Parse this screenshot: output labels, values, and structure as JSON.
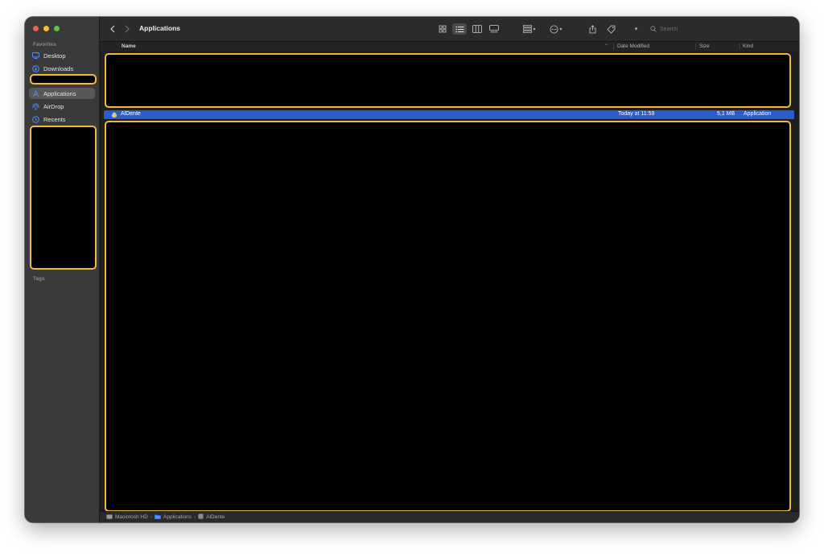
{
  "window": {
    "title": "Applications"
  },
  "sidebar": {
    "favorites_label": "Favorites",
    "tags_label": "Tags",
    "items": [
      {
        "label": "Desktop",
        "icon": "desktop-icon"
      },
      {
        "label": "Downloads",
        "icon": "downloads-icon"
      },
      {
        "label": "Applications",
        "icon": "applications-icon",
        "selected": true
      },
      {
        "label": "AirDrop",
        "icon": "airdrop-icon"
      },
      {
        "label": "Recents",
        "icon": "recents-icon"
      }
    ]
  },
  "toolbar": {
    "view_modes": [
      "icon-view-icon",
      "list-view-icon",
      "column-view-icon",
      "gallery-view-icon"
    ],
    "active_view": "list-view-icon",
    "search_placeholder": "Search"
  },
  "columns": {
    "name": "Name",
    "date_modified": "Date Modified",
    "size": "Size",
    "kind": "Kind"
  },
  "files": [
    {
      "name": "AlDente",
      "date_modified": "Today at 11:59",
      "size": "5,1 MB",
      "kind": "Application",
      "selected": true
    }
  ],
  "path_bar": [
    "Macintosh HD",
    "Applications",
    "AlDente"
  ],
  "colors": {
    "accent": "#2b5ccd",
    "redaction_border": "#f5b936",
    "sidebar_bg": "#3a3a3a",
    "content_bg": "#1e1e1e"
  }
}
